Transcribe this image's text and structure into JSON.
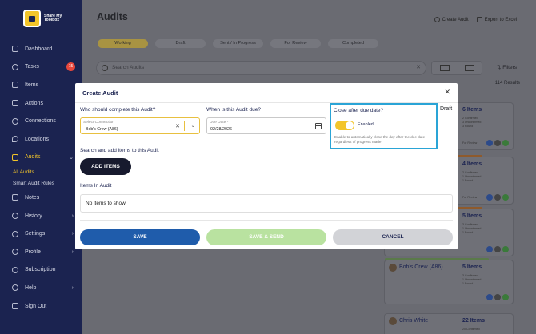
{
  "logo": {
    "text": "Share My Toolbox"
  },
  "sidebar": {
    "items": [
      {
        "label": "Dashboard",
        "icon": "grid-icon"
      },
      {
        "label": "Tasks",
        "icon": "check-circle-icon",
        "badge": "15"
      },
      {
        "label": "Items",
        "icon": "box-icon"
      },
      {
        "label": "Actions",
        "icon": "action-icon"
      },
      {
        "label": "Connections",
        "icon": "user-icon"
      },
      {
        "label": "Locations",
        "icon": "pin-icon"
      },
      {
        "label": "Audits",
        "icon": "audit-icon"
      },
      {
        "label": "Notes",
        "icon": "note-icon"
      },
      {
        "label": "History",
        "icon": "history-icon"
      },
      {
        "label": "Settings",
        "icon": "gear-icon"
      },
      {
        "label": "Profile",
        "icon": "profile-icon"
      },
      {
        "label": "Subscription",
        "icon": "card-icon"
      },
      {
        "label": "Help",
        "icon": "help-icon"
      },
      {
        "label": "Sign Out",
        "icon": "signout-icon"
      }
    ],
    "sub_items": [
      {
        "label": "All Audits"
      },
      {
        "label": "Smart Audit Rules"
      }
    ]
  },
  "page": {
    "title": "Audits",
    "create_audit": "Create Audit",
    "export": "Export to Excel",
    "tabs": [
      "Working",
      "Draft",
      "Sent / In Progress",
      "For Review",
      "Completed"
    ],
    "search_placeholder": "Search Audits",
    "filters": "Filters",
    "results": "114 Results"
  },
  "cards": [
    {
      "name": "",
      "items": "6 Items",
      "meta": [
        "2 Confirmed",
        "3 Unconfirmed",
        "3 Found"
      ],
      "foot": "For Review"
    },
    {
      "name": "",
      "items": "4 Items",
      "meta": [
        "2 Confirmed",
        "1 Unconfirmed",
        "1 Found"
      ],
      "foot": "For Review"
    },
    {
      "name": "",
      "items": "5 Items",
      "meta": [
        "3 Confirmed",
        "1 Unconfirmed",
        "1 Found"
      ],
      "foot": "For Review"
    },
    {
      "name": "Bob's Crew (A86)",
      "items": "5 Items",
      "meta": [
        "3 Confirmed",
        "1 Unconfirmed",
        "1 Found"
      ],
      "foot": "For Review"
    },
    {
      "name": "Chris White",
      "items": "22 Items",
      "meta": [
        "20 Confirmed"
      ],
      "foot": ""
    }
  ],
  "modal": {
    "title": "Create Audit",
    "who_label": "Who should complete this Audit?",
    "connection_placeholder": "Select Connection",
    "connection_value": "Bob's Crew (A86)",
    "due_label": "When is this Audit due?",
    "due_placeholder": "Due Date *",
    "due_value": "02/28/2026",
    "close_after_label": "Close after due date?",
    "enabled_label": "Enabled",
    "close_help": "Enable to automatically close the day after the due date regardless of progress made",
    "draft": "Draft",
    "search_add_label": "Search and add items to this Audit",
    "add_items": "ADD ITEMS",
    "items_in_audit_label": "Items In Audit",
    "no_items": "No items to show",
    "save": "SAVE",
    "save_send": "SAVE & SEND",
    "cancel": "CANCEL"
  },
  "colors": {
    "sidebar": "#1b2350",
    "accent": "#f3c52a",
    "primary_button": "#1f5cab",
    "highlight_border": "#2aa4d6"
  }
}
